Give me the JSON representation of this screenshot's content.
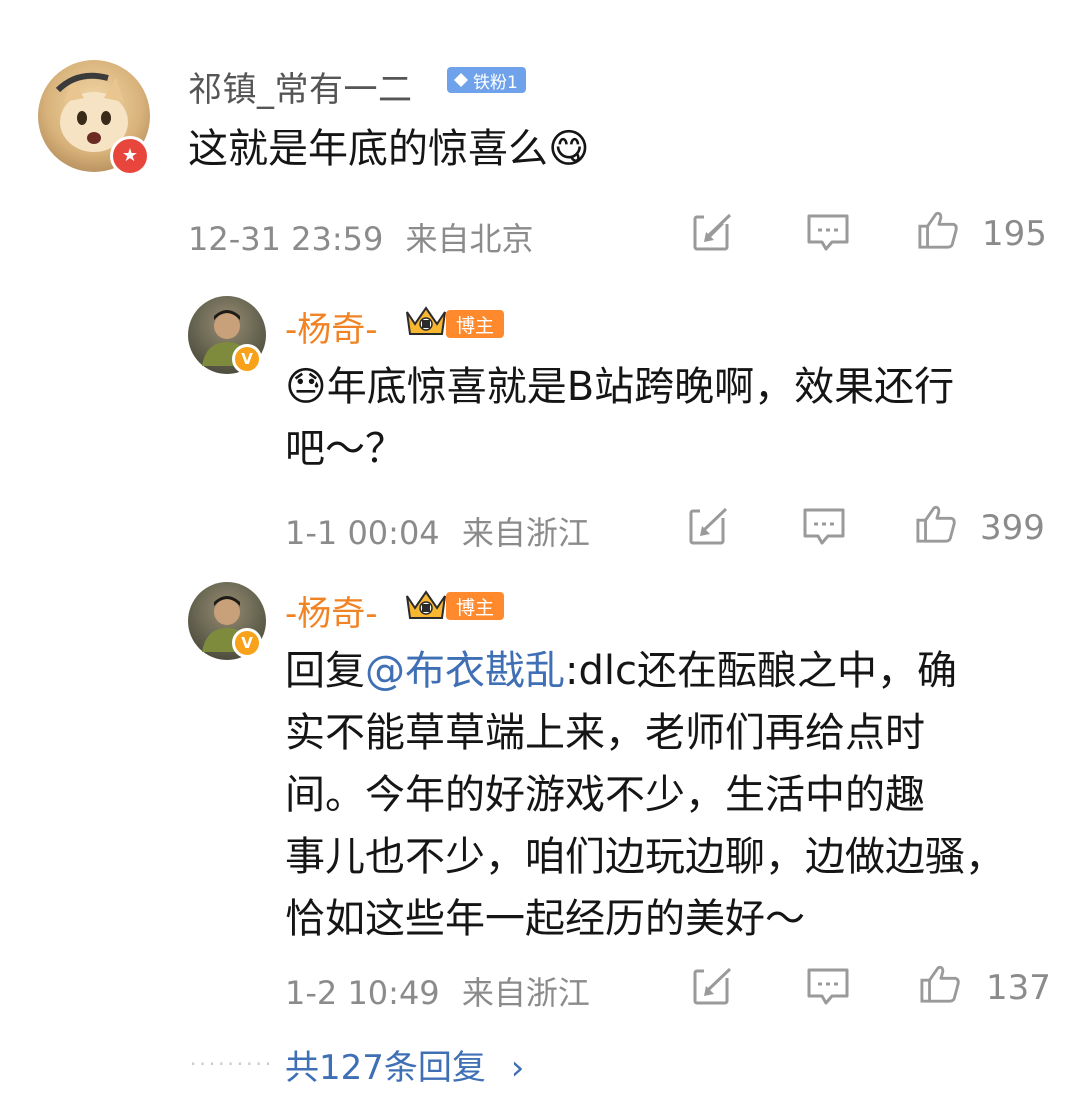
{
  "comment": {
    "author": "祁镇_常有一二",
    "fan_badge": "铁粉1",
    "text": "这就是年底的惊喜么",
    "emoji": "😋",
    "time": "12-31 23:59",
    "location": "来自北京",
    "likes": "195"
  },
  "replies": [
    {
      "author": "-杨奇-",
      "role_badge": "博主",
      "emoji": "😓",
      "text_line1": "年底惊喜就是B站跨晚啊，效果还行",
      "text_line2": "吧～？",
      "time": "1-1 00:04",
      "location": "来自浙江",
      "likes": "399"
    },
    {
      "author": "-杨奇-",
      "role_badge": "博主",
      "reply_prefix": "回复",
      "mention": "@布衣戡乱",
      "line1_rest": ":dlc还在酝酿之中，确",
      "line2": "实不能草草端上来，老师们再给点时",
      "line3": "间。今年的好游戏不少，生活中的趣",
      "line4": "事儿也不少，咱们边玩边聊，边做边骚，",
      "line5": "恰如这些年一起经历的美好～",
      "time": "1-2 10:49",
      "location": "来自浙江",
      "likes": "137"
    }
  ],
  "footer": {
    "dots": "·········",
    "more_replies": "共127条回复",
    "chevron": "›"
  },
  "icons": {
    "share": "share-icon",
    "comment": "comment-icon",
    "like": "like-icon"
  },
  "colors": {
    "accent_blue": "#3f6fb4",
    "host_orange": "#f08324",
    "meta_gray": "#8b8b8b"
  }
}
